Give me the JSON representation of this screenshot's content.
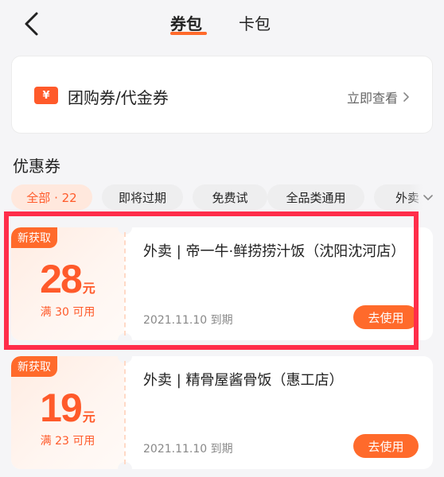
{
  "header": {
    "tabs": [
      {
        "label": "券包",
        "active": true
      },
      {
        "label": "卡包",
        "active": false
      }
    ]
  },
  "group_buy": {
    "icon_glyph": "¥",
    "title": "团购券/代金券",
    "link": "立即查看"
  },
  "section": {
    "title": "优惠券"
  },
  "filters": [
    {
      "label": "全部 · 22",
      "active": true
    },
    {
      "label": "即将过期",
      "active": false
    },
    {
      "label": "免费试",
      "active": false
    },
    {
      "label": "全品类通用",
      "active": false
    },
    {
      "label": "外卖",
      "active": false
    }
  ],
  "coupons": [
    {
      "tag": "新获取",
      "amount": "28",
      "unit": "元",
      "threshold": "满 30 可用",
      "title": "外卖 | 帝一牛·鲜捞捞汁饭（沈阳沈河店）",
      "expiry": "2021.11.10 到期",
      "button": "去使用"
    },
    {
      "tag": "新获取",
      "amount": "19",
      "unit": "元",
      "threshold": "满 23 可用",
      "title": "外卖 | 精骨屋酱骨饭（惠工店）",
      "expiry": "2021.11.10 到期",
      "button": "去使用"
    }
  ],
  "colors": {
    "accent": "#ff6a2b",
    "highlight": "#ff2d4a",
    "background": "#f5f5f7"
  }
}
